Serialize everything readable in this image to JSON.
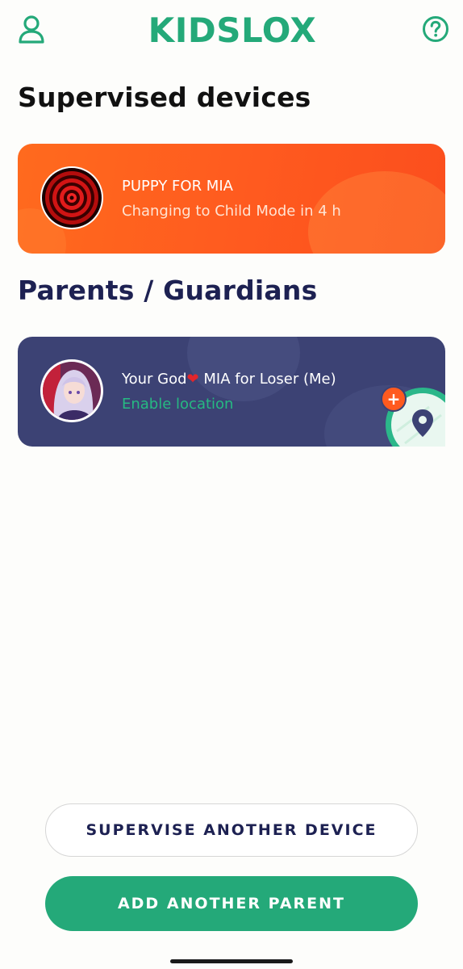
{
  "header": {
    "logo_text": "KIDSLOX",
    "profile_icon": "person-icon",
    "help_icon": "help-circle-icon"
  },
  "sections": {
    "devices_title": "Supervised devices",
    "parents_title": "Parents / Guardians"
  },
  "device_card": {
    "name": "PUPPY FOR MIA",
    "status": "Changing to Child Mode in 4 h",
    "avatar_icon": "hypnotic-spiral-avatar"
  },
  "parent_card": {
    "name_prefix": "Your God",
    "heart": "❤",
    "name_suffix": " MIA for Loser (Me)",
    "action": "Enable location",
    "avatar_icon": "anime-girl-avatar",
    "badge_icon": "location-pin-icon",
    "badge_plus": "+"
  },
  "buttons": {
    "supervise_label": "SUPERVISE ANOTHER DEVICE",
    "add_parent_label": "ADD ANOTHER PARENT"
  },
  "colors": {
    "brand_green": "#24a979",
    "device_orange": "#ff5a1f",
    "parent_navy": "#3c4274",
    "heading_navy": "#1d2152"
  }
}
